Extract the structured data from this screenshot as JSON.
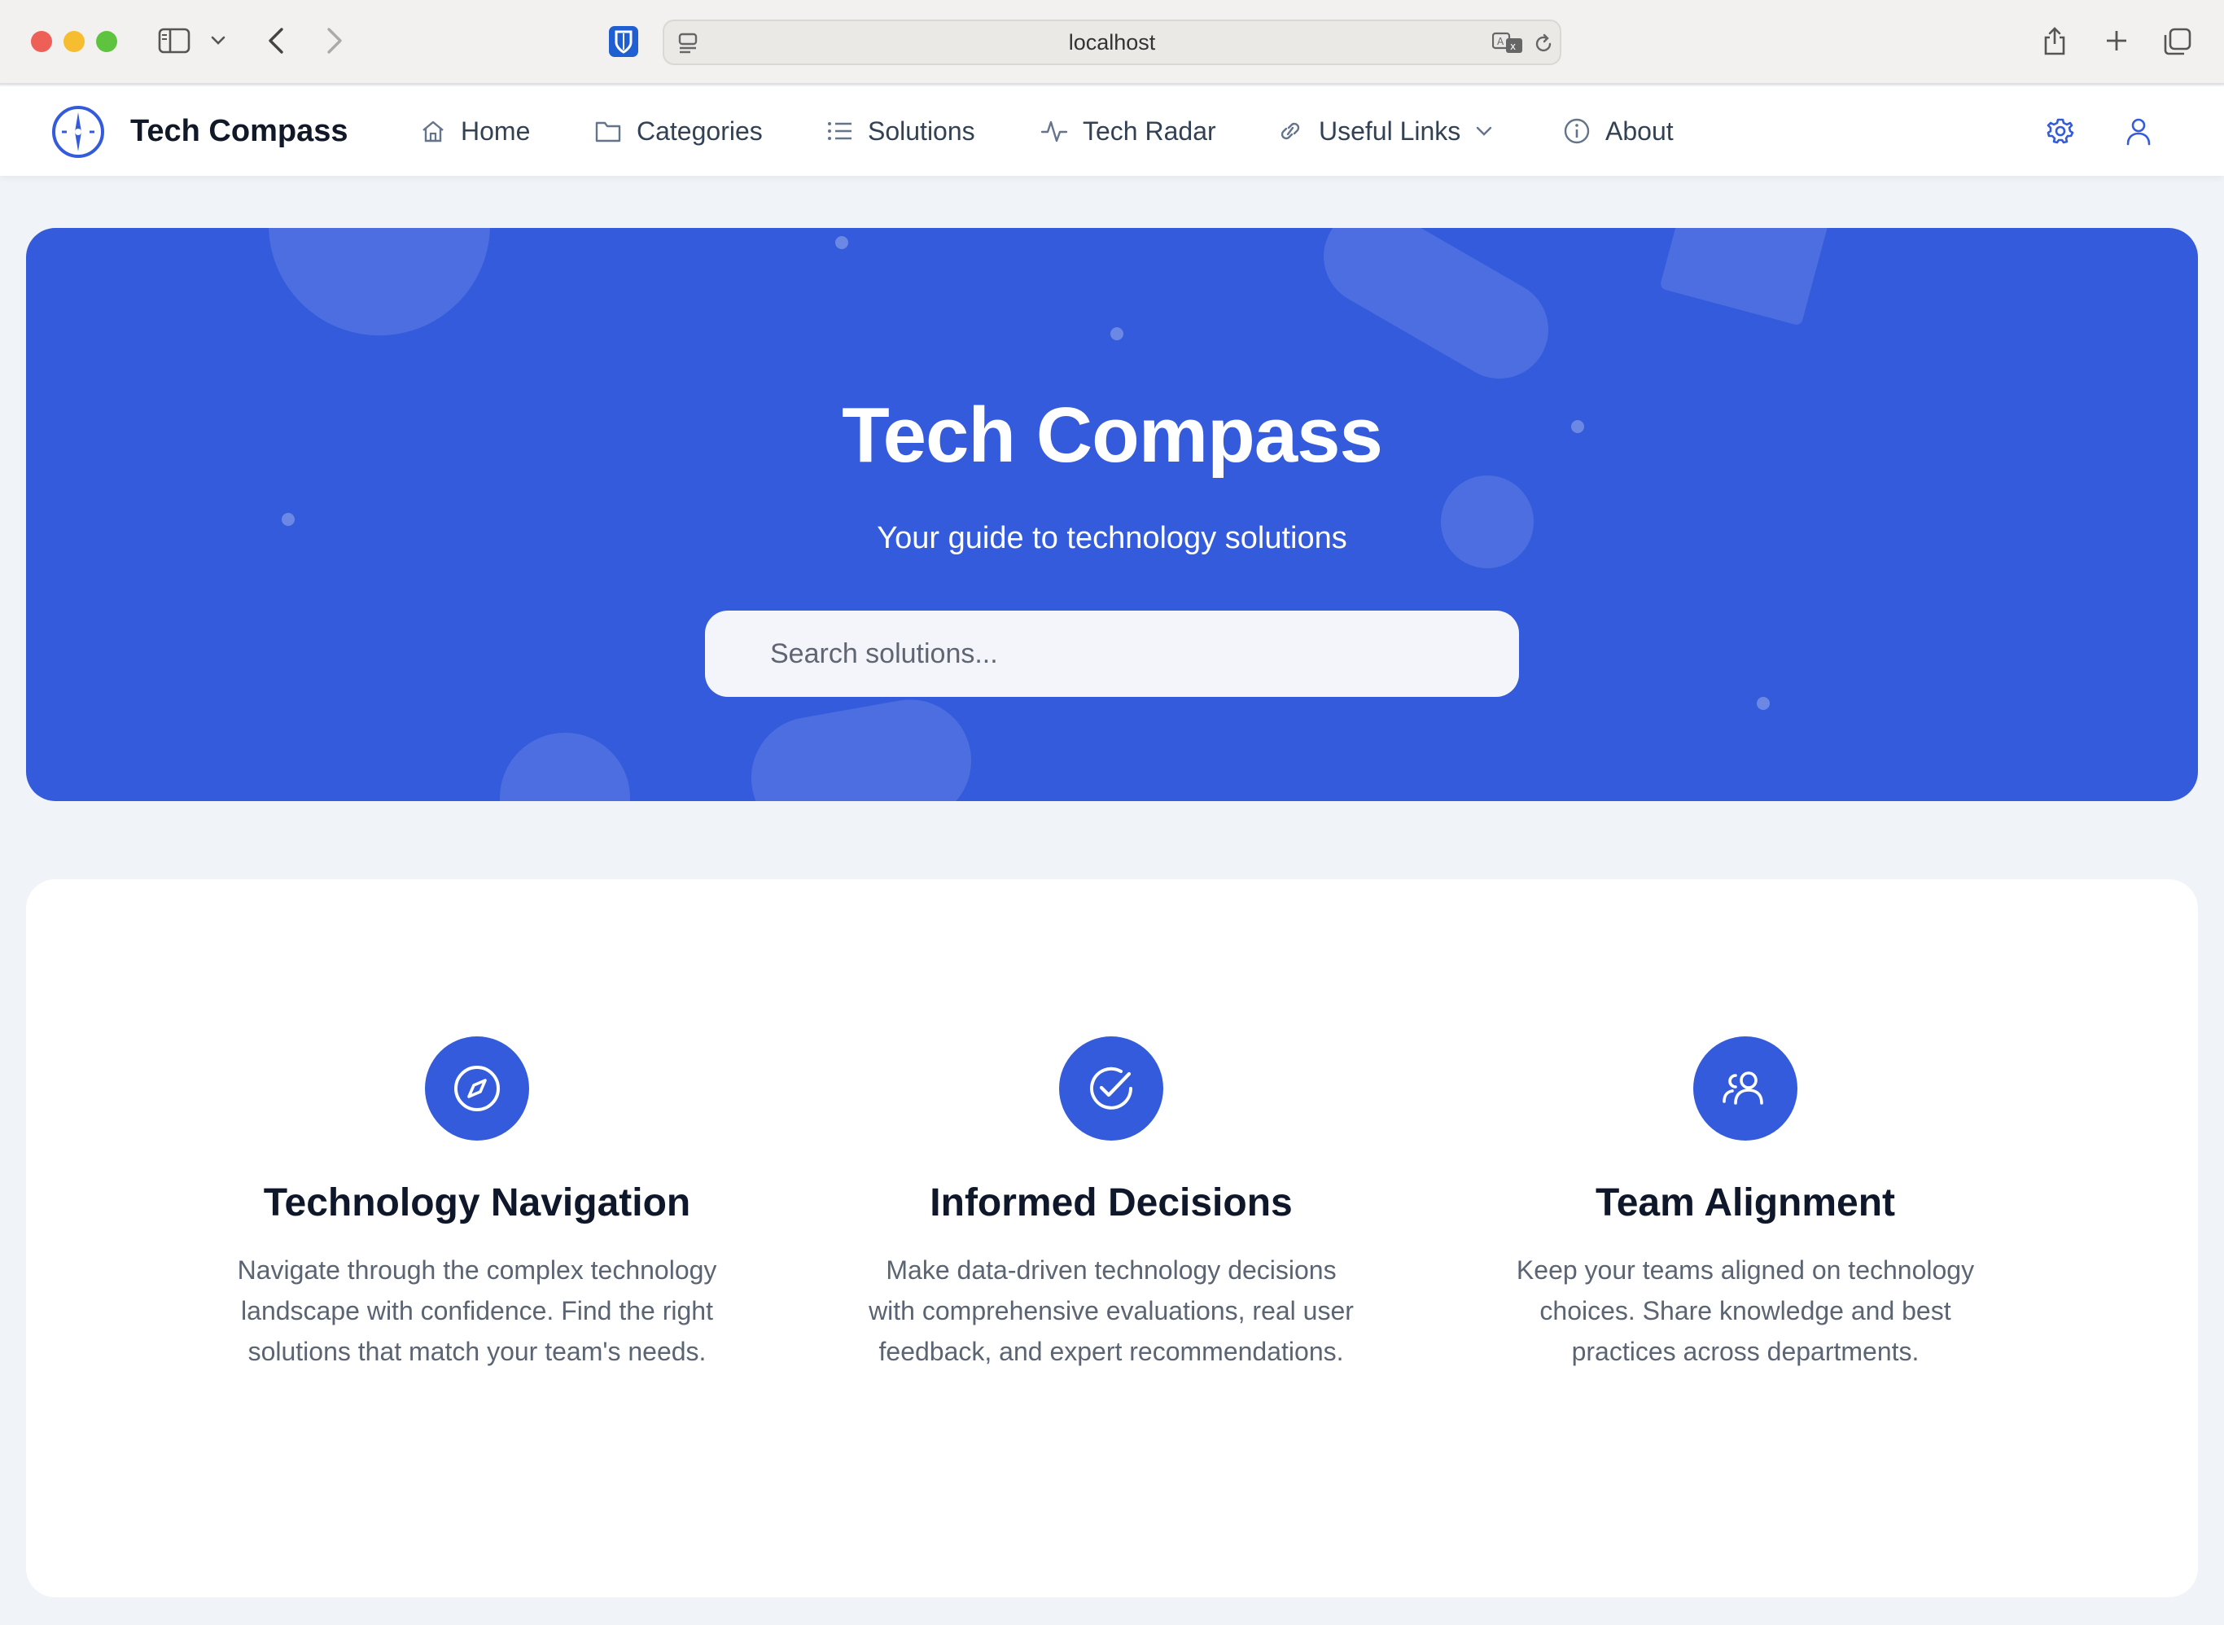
{
  "browser": {
    "url": "localhost"
  },
  "nav": {
    "brand": "Tech Compass",
    "items": [
      {
        "label": "Home",
        "icon": "home-icon"
      },
      {
        "label": "Categories",
        "icon": "folder-icon"
      },
      {
        "label": "Solutions",
        "icon": "list-icon"
      },
      {
        "label": "Tech Radar",
        "icon": "activity-icon"
      },
      {
        "label": "Useful Links",
        "icon": "link-icon",
        "has_dropdown": true
      },
      {
        "label": "About",
        "icon": "info-icon"
      }
    ],
    "right_icons": [
      "settings-icon",
      "user-icon"
    ]
  },
  "hero": {
    "title": "Tech Compass",
    "subtitle": "Your guide to technology solutions",
    "search_placeholder": "Search solutions..."
  },
  "features": [
    {
      "icon": "compass-icon",
      "title": "Technology Navigation",
      "description": "Navigate through the complex technology landscape with confidence. Find the right solutions that match your team's needs."
    },
    {
      "icon": "check-circle-icon",
      "title": "Informed Decisions",
      "description": "Make data-driven technology decisions with comprehensive evaluations, real user feedback, and expert recommendations."
    },
    {
      "icon": "users-icon",
      "title": "Team Alignment",
      "description": "Keep your teams aligned on technology choices. Share knowledge and best practices across departments."
    }
  ],
  "colors": {
    "primary": "#345bdc",
    "background": "#f0f3f8",
    "text_dark": "#0f172a",
    "text_muted": "#5b6472"
  }
}
